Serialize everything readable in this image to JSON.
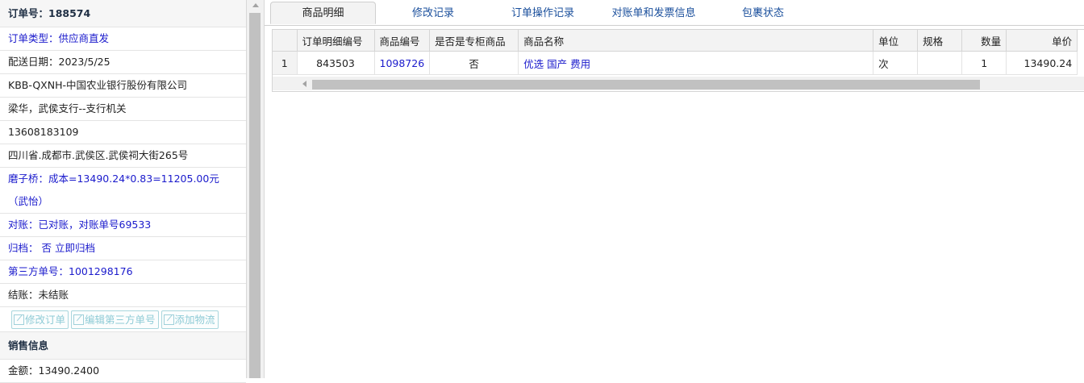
{
  "order": {
    "header": "订单号：188574",
    "type": "订单类型：供应商直发",
    "delivery_date": "配送日期：2023/5/25",
    "customer": "KBB-QXNH-中国农业银行股份有限公司",
    "contact": "梁华，武侯支行--支行机关",
    "phone": "13608183109",
    "address": "四川省.成都市.武侯区.武侯祠大街265号",
    "cost_note": "磨子桥：成本=13490.24*0.83=11205.00元（武怡）",
    "reconcile": "对账：已对账，对账单号69533",
    "archive_label": "归档：",
    "archive_value": "否",
    "archive_link": "立即归档",
    "third_party": "第三方单号：1001298176",
    "settle": "结账：未结账",
    "buttons": {
      "edit_order": "修改订单",
      "edit_third_party": "编辑第三方单号",
      "add_logistics": "添加物流"
    },
    "sales_header": "销售信息",
    "amount": "金额：13490.2400"
  },
  "tabs": [
    "商品明细",
    "修改记录",
    "订单操作记录",
    "对账单和发票信息",
    "包裹状态"
  ],
  "table": {
    "columns": [
      "订单明细编号",
      "商品编号",
      "是否是专柜商品",
      "商品名称",
      "单位",
      "规格",
      "数量",
      "单价"
    ],
    "rows": [
      {
        "row_no": "1",
        "detail_id": "843503",
        "product_id": "1098726",
        "is_counter": "否",
        "name": "优选 国产 费用",
        "unit": "次",
        "spec": "",
        "qty": "1",
        "price": "13490.24"
      }
    ]
  }
}
